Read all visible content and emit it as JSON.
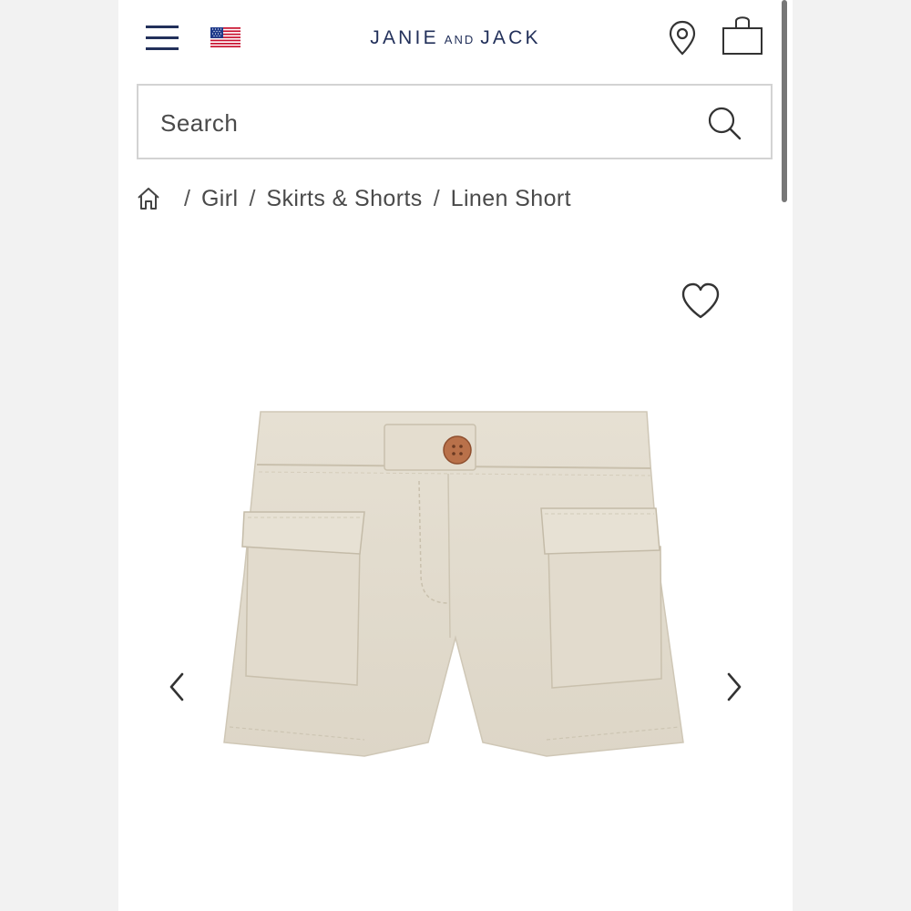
{
  "header": {
    "brand_left": "JANIE",
    "brand_mid": "AND",
    "brand_right": "JACK",
    "menu_icon": "hamburger-menu-icon",
    "flag_icon": "us-flag-icon",
    "location_icon": "location-pin-icon",
    "bag_icon": "shopping-bag-icon"
  },
  "search": {
    "placeholder": "Search",
    "icon": "search-icon"
  },
  "breadcrumb": {
    "home_icon": "home-icon",
    "separator": "/",
    "items": [
      "Girl",
      "Skirts & Shorts",
      "Linen Short"
    ]
  },
  "product": {
    "wishlist_icon": "heart-icon",
    "prev_icon": "chevron-left-icon",
    "next_icon": "chevron-right-icon"
  },
  "colors": {
    "brand_navy": "#22305a",
    "text_gray": "#4a4a4a",
    "border_gray": "#d3d3d3",
    "fabric_beige": "#e3ddd0"
  }
}
